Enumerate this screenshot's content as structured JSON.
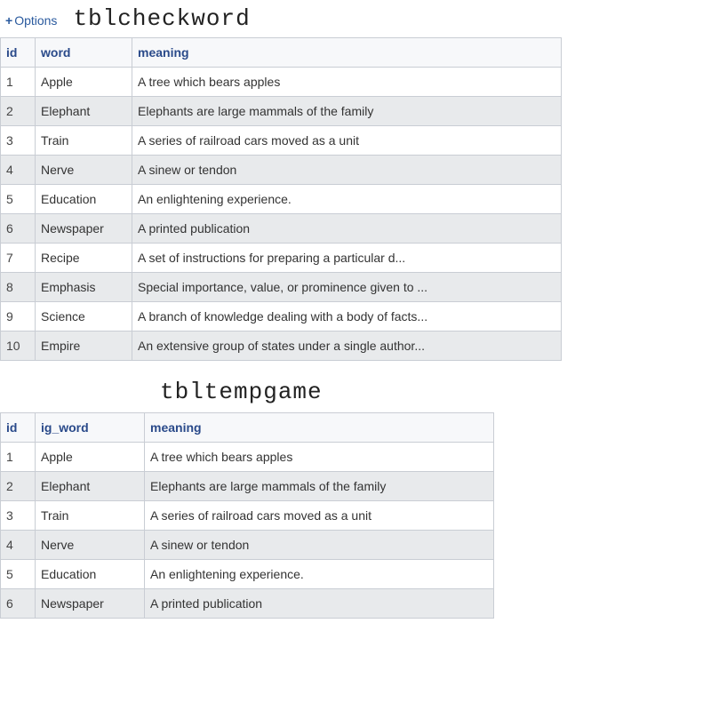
{
  "options_label": "Options",
  "table1": {
    "title": "tblcheckword",
    "headers": [
      "id",
      "word",
      "meaning"
    ],
    "rows": [
      {
        "id": "1",
        "word": "Apple",
        "meaning": "A tree which bears apples"
      },
      {
        "id": "2",
        "word": "Elephant",
        "meaning": "Elephants are large mammals of the family"
      },
      {
        "id": "3",
        "word": "Train",
        "meaning": "A series of railroad cars moved as a unit"
      },
      {
        "id": "4",
        "word": "Nerve",
        "meaning": "A sinew or tendon"
      },
      {
        "id": "5",
        "word": "Education",
        "meaning": "An enlightening experience."
      },
      {
        "id": "6",
        "word": "Newspaper",
        "meaning": "A printed publication"
      },
      {
        "id": "7",
        "word": "Recipe",
        "meaning": "A set of instructions for preparing a particular d..."
      },
      {
        "id": "8",
        "word": "Emphasis",
        "meaning": "Special importance, value, or prominence given to ..."
      },
      {
        "id": "9",
        "word": "Science",
        "meaning": "A branch of knowledge dealing with a body of facts..."
      },
      {
        "id": "10",
        "word": "Empire",
        "meaning": "An extensive group of states under a single author..."
      }
    ]
  },
  "table2": {
    "title": "tbltempgame",
    "headers": [
      "id",
      "ig_word",
      "meaning"
    ],
    "rows": [
      {
        "id": "1",
        "ig_word": "Apple",
        "meaning": "A tree which bears apples"
      },
      {
        "id": "2",
        "ig_word": "Elephant",
        "meaning": "Elephants are large mammals of the family"
      },
      {
        "id": "3",
        "ig_word": "Train",
        "meaning": "A series of railroad cars moved as a unit"
      },
      {
        "id": "4",
        "ig_word": "Nerve",
        "meaning": "A sinew or tendon"
      },
      {
        "id": "5",
        "ig_word": "Education",
        "meaning": "An enlightening experience."
      },
      {
        "id": "6",
        "ig_word": "Newspaper",
        "meaning": "A printed publication"
      }
    ]
  }
}
